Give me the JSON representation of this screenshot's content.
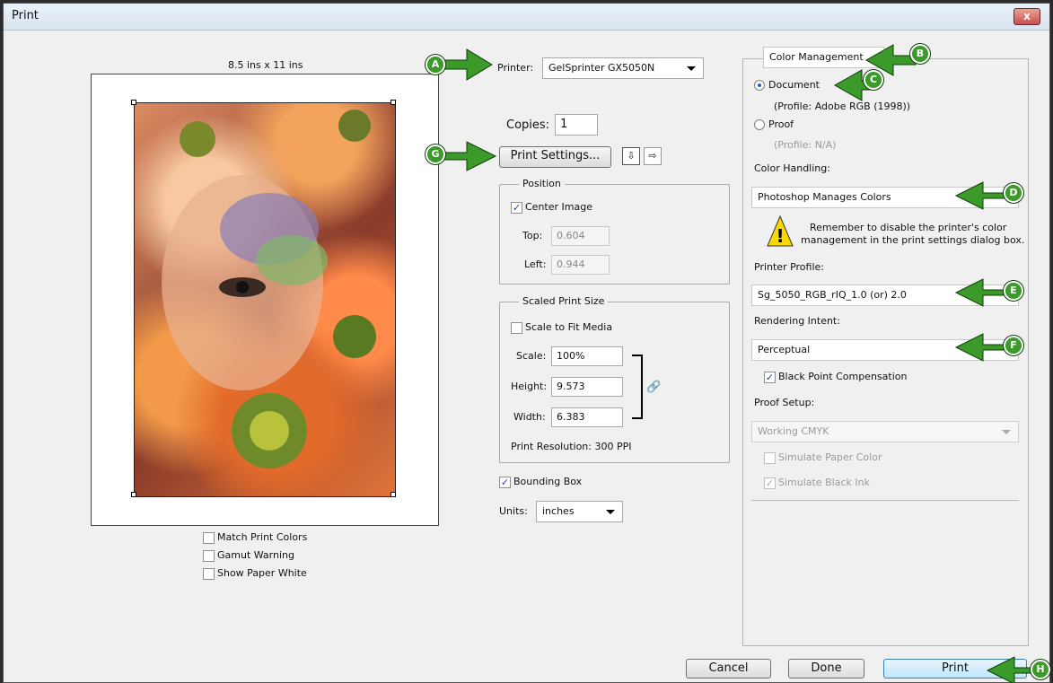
{
  "window": {
    "title": "Print",
    "close_label": "x"
  },
  "preview": {
    "size_label": "8.5 ins x 11 ins",
    "options": [
      {
        "label": "Match Print Colors",
        "checked": false
      },
      {
        "label": "Gamut Warning",
        "checked": false
      },
      {
        "label": "Show Paper White",
        "checked": false
      }
    ]
  },
  "printer": {
    "label": "Printer:",
    "value": "GelSprinter GX5050N"
  },
  "copies": {
    "label": "Copies:",
    "value": "1"
  },
  "print_settings": {
    "label": "Print Settings..."
  },
  "position": {
    "title": "Position",
    "center_image": "Center Image",
    "top_label": "Top:",
    "top_value": "0.604",
    "left_label": "Left:",
    "left_value": "0.944"
  },
  "scaled": {
    "title": "Scaled Print Size",
    "scale_to_fit": "Scale to Fit Media",
    "scale_label": "Scale:",
    "scale_value": "100%",
    "height_label": "Height:",
    "height_value": "9.573",
    "width_label": "Width:",
    "width_value": "6.383",
    "resolution": "Print Resolution: 300 PPI"
  },
  "bounding_box": "Bounding Box",
  "units": {
    "label": "Units:",
    "value": "inches"
  },
  "color_mgmt": {
    "dropdown": "Color Management",
    "document_label": "Document",
    "document_profile": "(Profile: Adobe RGB (1998))",
    "proof_label": "Proof",
    "proof_profile": "(Profile: N/A)",
    "color_handling_label": "Color Handling:",
    "color_handling_value": "Photoshop Manages Colors",
    "warning_line1": "Remember to disable the printer's color",
    "warning_line2": "management in the print settings dialog box.",
    "printer_profile_label": "Printer Profile:",
    "printer_profile_value": "Sg_5050_RGB_rIQ_1.0 (or) 2.0",
    "rendering_intent_label": "Rendering Intent:",
    "rendering_intent_value": "Perceptual",
    "black_point": "Black Point Compensation",
    "proof_setup_label": "Proof Setup:",
    "proof_setup_value": "Working CMYK",
    "simulate_paper": "Simulate Paper Color",
    "simulate_ink": "Simulate Black Ink"
  },
  "buttons": {
    "cancel": "Cancel",
    "done": "Done",
    "print": "Print"
  },
  "callouts": {
    "a": "A",
    "b": "B",
    "c": "C",
    "d": "D",
    "e": "E",
    "f": "F",
    "g": "G",
    "h": "H"
  },
  "colors": {
    "callout_green": "#3c9a2a",
    "accent_blue": "#1e5fc6"
  }
}
